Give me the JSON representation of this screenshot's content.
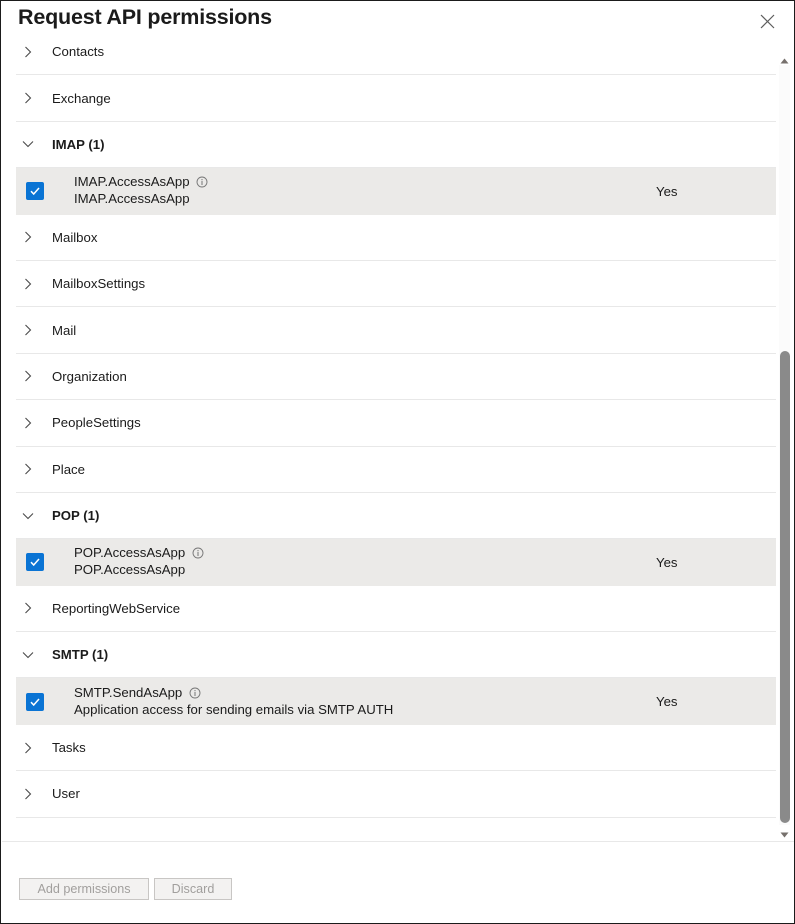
{
  "panel": {
    "title": "Request API permissions",
    "close_icon": "close-icon"
  },
  "scroll": {
    "up_arrow_icon": "scroll-up-arrow-icon",
    "down_arrow_icon": "scroll-down-arrow-icon",
    "thumb": "scrollbar-thumb"
  },
  "list": {
    "clipped_top_row": {
      "label": "Contacts",
      "expanded": false,
      "icon": "chevron-right-icon"
    },
    "items": [
      {
        "type": "group",
        "label": "Exchange",
        "expanded": false,
        "icon": "chevron-right-icon"
      },
      {
        "type": "group",
        "label": "IMAP (1)",
        "expanded": true,
        "icon": "chevron-down-icon"
      },
      {
        "type": "permission",
        "checked": true,
        "name": "IMAP.AccessAsApp",
        "description": "IMAP.AccessAsApp",
        "admin_consent": "Yes",
        "info_icon": "info-circle-icon"
      },
      {
        "type": "group",
        "label": "Mailbox",
        "expanded": false,
        "icon": "chevron-right-icon"
      },
      {
        "type": "group",
        "label": "MailboxSettings",
        "expanded": false,
        "icon": "chevron-right-icon"
      },
      {
        "type": "group",
        "label": "Mail",
        "expanded": false,
        "icon": "chevron-right-icon"
      },
      {
        "type": "group",
        "label": "Organization",
        "expanded": false,
        "icon": "chevron-right-icon"
      },
      {
        "type": "group",
        "label": "PeopleSettings",
        "expanded": false,
        "icon": "chevron-right-icon"
      },
      {
        "type": "group",
        "label": "Place",
        "expanded": false,
        "icon": "chevron-right-icon"
      },
      {
        "type": "group",
        "label": "POP (1)",
        "expanded": true,
        "icon": "chevron-down-icon"
      },
      {
        "type": "permission",
        "checked": true,
        "name": "POP.AccessAsApp",
        "description": "POP.AccessAsApp",
        "admin_consent": "Yes",
        "info_icon": "info-circle-icon"
      },
      {
        "type": "group",
        "label": "ReportingWebService",
        "expanded": false,
        "icon": "chevron-right-icon"
      },
      {
        "type": "group",
        "label": "SMTP (1)",
        "expanded": true,
        "icon": "chevron-down-icon"
      },
      {
        "type": "permission",
        "checked": true,
        "name": "SMTP.SendAsApp",
        "description": "Application access for sending emails via SMTP AUTH",
        "admin_consent": "Yes",
        "info_icon": "info-circle-icon"
      },
      {
        "type": "group",
        "label": "Tasks",
        "expanded": false,
        "icon": "chevron-right-icon"
      },
      {
        "type": "group",
        "label": "User",
        "expanded": false,
        "icon": "chevron-right-icon"
      }
    ]
  },
  "footer": {
    "add_permissions_label": "Add permissions",
    "discard_label": "Discard",
    "add_permissions_disabled": true,
    "discard_disabled": true
  },
  "colors": {
    "accent": "#0a74d4",
    "row_selected_bg": "#ebeae8",
    "text": "#1b1b1b",
    "divider": "#e8e8e8",
    "disabled_text": "#a19f9d",
    "scrollbar_thumb": "#8a8a8a"
  }
}
